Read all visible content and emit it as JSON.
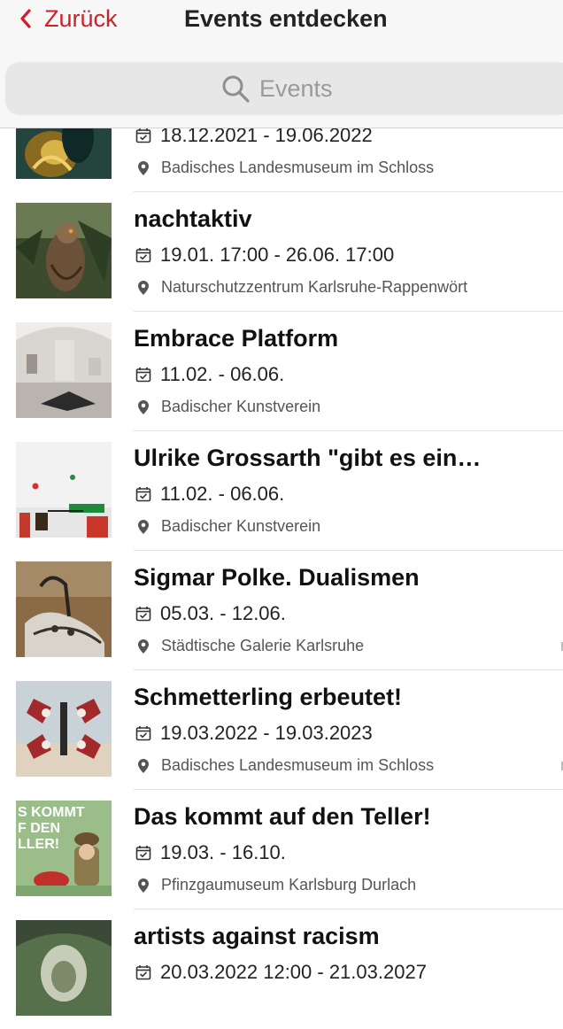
{
  "nav": {
    "back_label": "Zurück",
    "title": "Events entdecken"
  },
  "search": {
    "placeholder": "Events"
  },
  "colors": {
    "accent": "#d21f2a"
  },
  "icons": {
    "back": "chevron-left-icon",
    "search": "search-icon",
    "date": "calendar-check-icon",
    "location": "map-pin-icon"
  },
  "events": [
    {
      "title": "",
      "date": "18.12.2021 - 19.06.2022",
      "location": "Badisches Landesmuseum im Schloss"
    },
    {
      "title": "nachtaktiv",
      "date": "19.01. 17:00 - 26.06. 17:00",
      "location": "Naturschutzzentrum Karlsruhe-Rappenwört"
    },
    {
      "title": "Embrace Platform",
      "date": "11.02. - 06.06.",
      "location": "Badischer Kunstverein"
    },
    {
      "title": "Ulrike Grossarth \"gibt es ein…",
      "date": "11.02. - 06.06.",
      "location": "Badischer Kunstverein"
    },
    {
      "title": "Sigmar Polke. Dualismen",
      "date": "05.03. - 12.06.",
      "location": "Städtische Galerie Karlsruhe"
    },
    {
      "title": "Schmetterling erbeutet!",
      "date": "19.03.2022 - 19.03.2023",
      "location": "Badisches Landesmuseum im Schloss"
    },
    {
      "title": "Das kommt auf den Teller!",
      "date": "19.03. - 16.10.",
      "location": "Pfinzgaumuseum Karlsburg Durlach"
    },
    {
      "title": "artists against racism",
      "date": "20.03.2022 12:00 - 21.03.2027",
      "location": ""
    }
  ],
  "thumb_texts": {
    "teller": [
      "S KOMMT",
      "F DEN",
      "LLER!"
    ]
  }
}
